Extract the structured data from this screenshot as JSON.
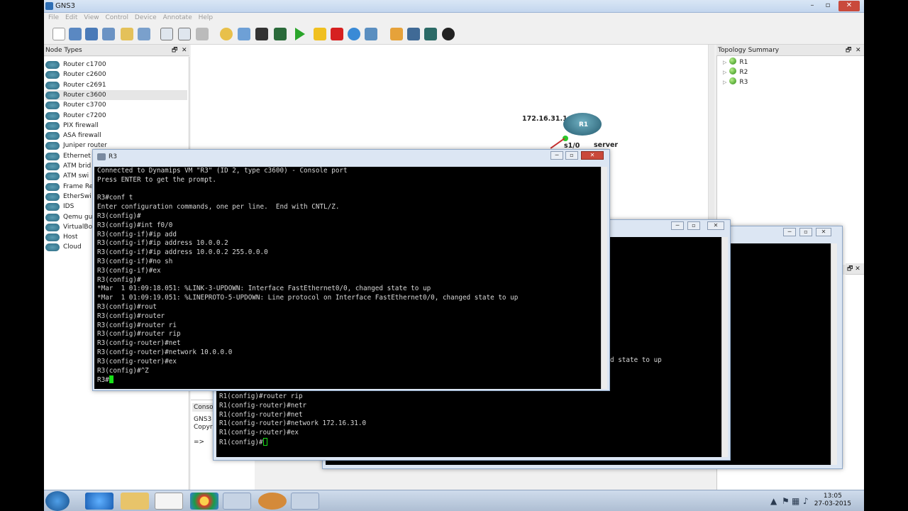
{
  "window": {
    "title": "GNS3",
    "min": "–",
    "max": "▫",
    "close": "✕"
  },
  "menu": [
    "File",
    "Edit",
    "View",
    "Control",
    "Device",
    "Annotate",
    "Help"
  ],
  "toolbar_icons": [
    "new-icon",
    "open-icon",
    "save-icon",
    "save-as-icon",
    "folder-icon",
    "import-icon",
    "link-icon",
    "hostnames-icon",
    "pointer-icon",
    "clock-icon",
    "config-icon",
    "aux-icon",
    "console-icon",
    "start-icon",
    "suspend-icon",
    "stop-icon",
    "reload-icon",
    "box-icon",
    "note-icon",
    "picture-icon",
    "rectangle-icon",
    "ellipse-icon"
  ],
  "node_types": {
    "title": "Node Types",
    "items": [
      "Router c1700",
      "Router c2600",
      "Router c2691",
      "Router c3600",
      "Router c3700",
      "Router c7200",
      "PIX firewall",
      "ASA firewall",
      "Juniper router",
      "Ethernet",
      "ATM brid",
      "ATM swi",
      "Frame Re",
      "EtherSwi",
      "IDS",
      "Qemu gu",
      "VirtualBo",
      "Host",
      "Cloud"
    ],
    "selected_index": 3
  },
  "topology": {
    "title": "Topology Summary",
    "items": [
      "R1",
      "R2",
      "R3"
    ],
    "panel3_btns": "🗗 ✕"
  },
  "canvas": {
    "ip_label": "172.16.31.1",
    "router_label": "R1",
    "iface_label": "s1/0",
    "server_label": "server"
  },
  "console_panel": {
    "tab": "Console",
    "line1": "GNS3",
    "line2": "Copyri",
    "prompt": "=>"
  },
  "r3": {
    "title": "R3",
    "lines": [
      "Connected to Dynamips VM \"R3\" (ID 2, type c3600) - Console port",
      "Press ENTER to get the prompt.",
      "",
      "R3#conf t",
      "Enter configuration commands, one per line.  End with CNTL/Z.",
      "R3(config)#",
      "R3(config)#int f0/0",
      "R3(config-if)#ip add",
      "R3(config-if)#ip address 10.0.0.2",
      "R3(config-if)#ip address 10.0.0.2 255.0.0.0",
      "R3(config-if)#no sh",
      "R3(config-if)#ex",
      "R3(config)#",
      "*Mar  1 01:09:18.051: %LINK-3-UPDOWN: Interface FastEthernet0/0, changed state to up",
      "*Mar  1 01:09:19.051: %LINEPROTO-5-UPDOWN: Line protocol on Interface FastEthernet0/0, changed state to up",
      "R3(config)#rout",
      "R3(config)#router",
      "R3(config)#router ri",
      "R3(config)#router rip",
      "R3(config-router)#net",
      "R3(config-router)#network 10.0.0.0",
      "R3(config-router)#ex",
      "R3(config)#^Z"
    ],
    "prompt": "R3#"
  },
  "r1": {
    "partial_line": "d state to up",
    "lines": [
      "R1(config)#router rip",
      "R1(config-router)#netr",
      "R1(config-router)#net",
      "R1(config-router)#network 172.16.31.0",
      "R1(config-router)#ex"
    ],
    "prompt": "R1(config)#"
  },
  "taskbar": {
    "time": "13:05",
    "date": "27-03-2015"
  }
}
